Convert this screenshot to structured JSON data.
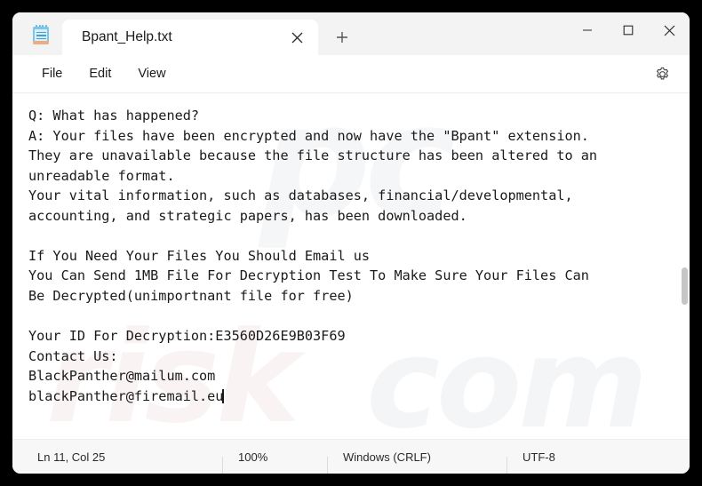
{
  "window": {
    "app_icon": "notepad-icon",
    "controls": {
      "minimize": "minimize-icon",
      "maximize": "maximize-icon",
      "close": "close-icon"
    }
  },
  "tabbar": {
    "tab_title": "Bpant_Help.txt",
    "close_tab_icon": "close-icon",
    "new_tab_icon": "plus-icon"
  },
  "menubar": {
    "items": [
      {
        "label": "File"
      },
      {
        "label": "Edit"
      },
      {
        "label": "View"
      }
    ],
    "settings_icon": "gear-icon"
  },
  "editor": {
    "content": "Q: What has happened?\nA: Your files have been encrypted and now have the \"Bpant\" extension.\nThey are unavailable because the file structure has been altered to an\nunreadable format.\nYour vital information, such as databases, financial/developmental,\naccounting, and strategic papers, has been downloaded.\n\nIf You Need Your Files You Should Email us\nYou Can Send 1MB File For Decryption Test To Make Sure Your Files Can\nBe Decrypted(unimportnant file for free)\n\nYour ID For Decryption:E3560D26E9B03F69\nContact Us:\nBlackPanther@mailum.com\nblackPanther@firemail.eu",
    "lines": [
      "Q: What has happened?",
      "A: Your files have been encrypted and now have the \"Bpant\" extension.",
      "They are unavailable because the file structure has been altered to an",
      "unreadable format.",
      "Your vital information, such as databases, financial/developmental,",
      "accounting, and strategic papers, has been downloaded.",
      "",
      "If You Need Your Files You Should Email us",
      "You Can Send 1MB File For Decryption Test To Make Sure Your Files Can",
      "Be Decrypted(unimportnant file for free)",
      "",
      "Your ID For Decryption:E3560D26E9B03F69",
      "Contact Us:",
      "BlackPanther@mailum.com",
      "blackPanther@firemail.eu"
    ],
    "decryption_id": "E3560D26E9B03F69",
    "emails": [
      "BlackPanther@mailum.com",
      "blackPanther@firemail.eu"
    ],
    "watermark": {
      "part1": "pc",
      "part2": "risk",
      "part3": "com"
    }
  },
  "statusbar": {
    "cursor_position": "Ln 11, Col 25",
    "zoom": "100%",
    "line_ending": "Windows (CRLF)",
    "encoding": "UTF-8"
  },
  "colors": {
    "desktop": "#000000",
    "window_chrome": "#f3f3f3",
    "editor_bg": "#ffffff",
    "text": "#1a1a1a",
    "status_bg": "#f7f7f7",
    "icon_accent": "#7cc7e8"
  }
}
